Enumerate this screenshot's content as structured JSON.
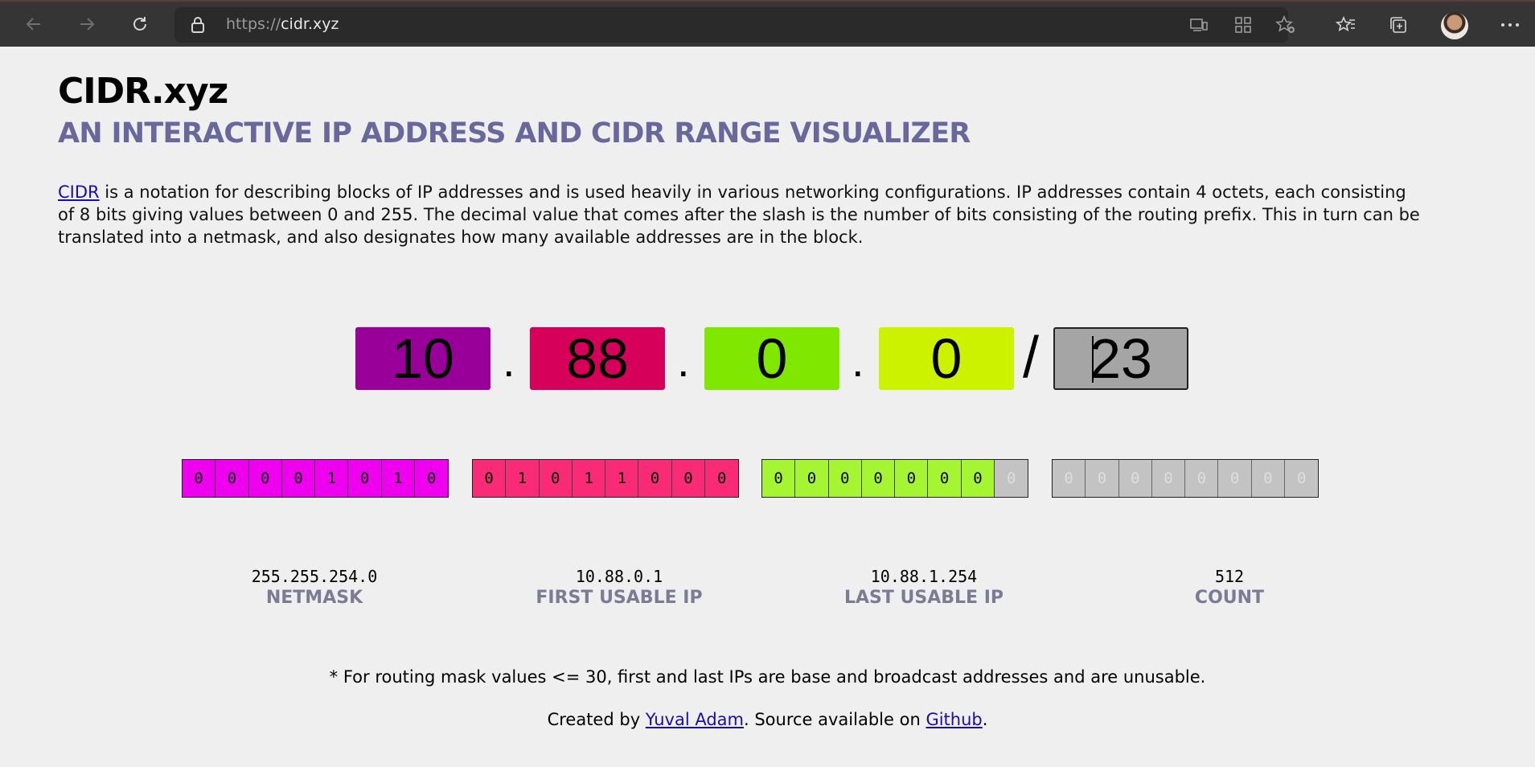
{
  "browser": {
    "url_scheme": "https://",
    "url_host": "cidr.xyz"
  },
  "page": {
    "title": "CIDR.xyz",
    "subtitle": "AN INTERACTIVE IP ADDRESS AND CIDR RANGE VISUALIZER",
    "description_link": "CIDR",
    "description_rest": " is a notation for describing blocks of IP addresses and is used heavily in various networking configurations. IP addresses contain 4 octets, each consisting of 8 bits giving values between 0 and 255. The decimal value that comes after the slash is the number of bits consisting of the routing prefix. This in turn can be translated into a netmask, and also designates how many available addresses are in the block."
  },
  "ip": {
    "octets": [
      {
        "value": "10",
        "color": "#990099"
      },
      {
        "value": "88",
        "color": "#d6005a"
      },
      {
        "value": "0",
        "color": "#80e800"
      },
      {
        "value": "0",
        "color": "#ccf200"
      }
    ],
    "separator": ".",
    "slash": "/",
    "mask": "23"
  },
  "bits": {
    "colors": [
      "#ee00ee",
      "#fa2b76",
      "#a6f533",
      "#c3c3c3"
    ],
    "off_color": "#c3c3c3",
    "groups": [
      [
        "0",
        "0",
        "0",
        "0",
        "1",
        "0",
        "1",
        "0"
      ],
      [
        "0",
        "1",
        "0",
        "1",
        "1",
        "0",
        "0",
        "0"
      ],
      [
        "0",
        "0",
        "0",
        "0",
        "0",
        "0",
        "0",
        "0"
      ],
      [
        "0",
        "0",
        "0",
        "0",
        "0",
        "0",
        "0",
        "0"
      ]
    ],
    "prefix_length": 23
  },
  "results": [
    {
      "value": "255.255.254.0",
      "label": "NETMASK"
    },
    {
      "value": "10.88.0.1",
      "label": "FIRST USABLE IP"
    },
    {
      "value": "10.88.1.254",
      "label": "LAST USABLE IP"
    },
    {
      "value": "512",
      "label": "COUNT"
    }
  ],
  "footer": {
    "note": "* For routing mask values <= 30, first and last IPs are base and broadcast addresses and are unusable.",
    "credit_prefix": "Created by ",
    "author": "Yuval Adam",
    "credit_middle": ". Source available on ",
    "source": "Github",
    "credit_suffix": "."
  }
}
